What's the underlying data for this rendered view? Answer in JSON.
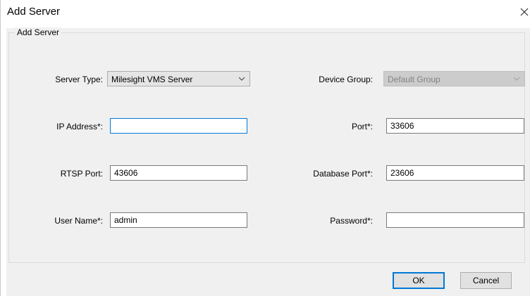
{
  "window": {
    "title": "Add Server"
  },
  "group": {
    "legend": "Add Server"
  },
  "fields": {
    "server_type": {
      "label": "Server Type:",
      "value": "Milesight VMS Server"
    },
    "device_group": {
      "label": "Device Group:",
      "value": "Default Group"
    },
    "ip_address": {
      "label": "IP Address*:",
      "value": ""
    },
    "port": {
      "label": "Port*:",
      "value": "33606"
    },
    "rtsp_port": {
      "label": "RTSP Port:",
      "value": "43606"
    },
    "database_port": {
      "label": "Database Port*:",
      "value": "23606"
    },
    "user_name": {
      "label": "User Name*:",
      "value": "admin"
    },
    "password": {
      "label": "Password*:",
      "value": ""
    }
  },
  "buttons": {
    "ok": "OK",
    "cancel": "Cancel"
  },
  "icons": {
    "close": "close-icon",
    "dropdown": "chevron-down-icon"
  },
  "colors": {
    "focus_border": "#0078d7",
    "dialog_bg": "#f0f0f0",
    "disabled_bg": "#cccccc"
  }
}
